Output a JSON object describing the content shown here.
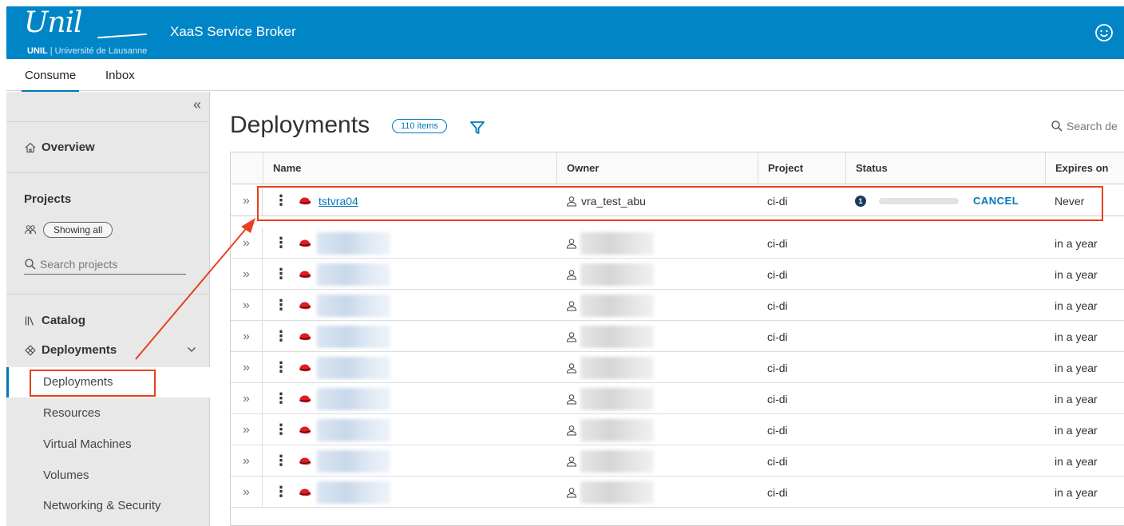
{
  "header": {
    "logo_script": "Unil",
    "logo_sub_bold": "UNIL",
    "logo_sub_sep": " | ",
    "logo_sub_text": "Université de Lausanne",
    "app_title": "XaaS Service Broker",
    "user_icon": "smiley-user-icon"
  },
  "tabs": [
    {
      "label": "Consume",
      "active": true
    },
    {
      "label": "Inbox",
      "active": false
    }
  ],
  "sidebar": {
    "collapse_glyph": "«",
    "overview": "Overview",
    "projects_title": "Projects",
    "showing_all": "Showing all",
    "search_projects_placeholder": "Search projects",
    "catalog": "Catalog",
    "deployments_group": "Deployments",
    "sub_items": [
      "Deployments",
      "Resources",
      "Virtual Machines",
      "Volumes",
      "Networking & Security"
    ],
    "active_sub_item": "Deployments"
  },
  "main": {
    "title": "Deployments",
    "count_badge": "110 items",
    "search_placeholder": "Search de",
    "columns": [
      "Name",
      "Owner",
      "Project",
      "Status",
      "Expires on"
    ],
    "rows": [
      {
        "name": "tstvra04",
        "owner": "vra_test_abu",
        "project": "ci-di",
        "status_step": "1",
        "status_action": "CANCEL",
        "expires": "Never"
      },
      {
        "name": "",
        "owner": "",
        "project": "ci-di",
        "expires": "in a year"
      },
      {
        "name": "",
        "owner": "",
        "project": "ci-di",
        "expires": "in a year"
      },
      {
        "name": "",
        "owner": "",
        "project": "ci-di",
        "expires": "in a year"
      },
      {
        "name": "",
        "owner": "",
        "project": "ci-di",
        "expires": "in a year"
      },
      {
        "name": "",
        "owner": "",
        "project": "ci-di",
        "expires": "in a year"
      },
      {
        "name": "",
        "owner": "",
        "project": "ci-di",
        "expires": "in a year"
      },
      {
        "name": "",
        "owner": "",
        "project": "ci-di",
        "expires": "in a year"
      },
      {
        "name": "",
        "owner": "",
        "project": "ci-di",
        "expires": "in a year"
      },
      {
        "name": "",
        "owner": "",
        "project": "ci-di",
        "expires": "in a year"
      }
    ]
  },
  "colors": {
    "header_bg": "#0086c7",
    "accent": "#0079b8",
    "annotation": "#e8401c",
    "redhat": "#e11b22"
  }
}
